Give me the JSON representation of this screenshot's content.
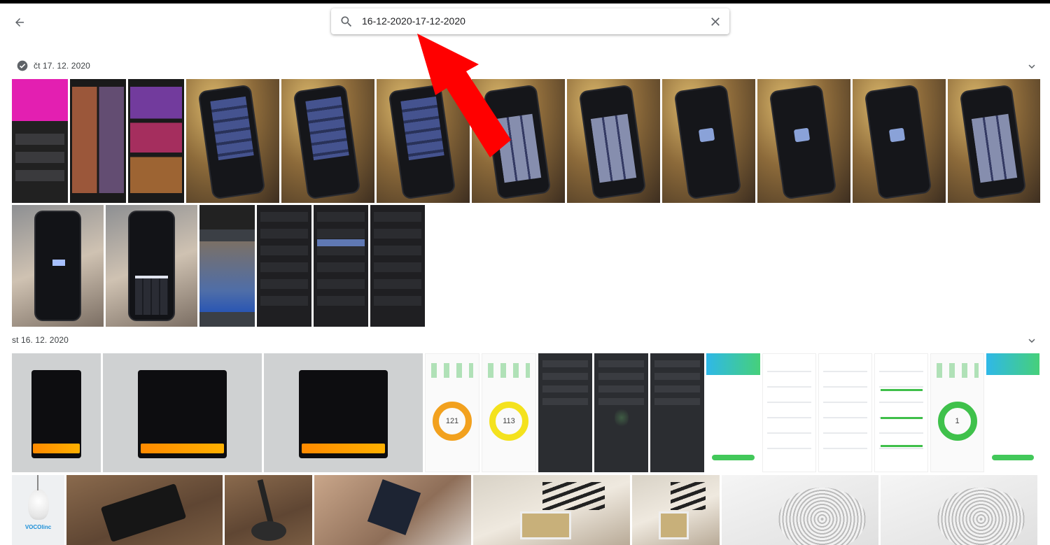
{
  "search": {
    "value": "16-12-2020-17-12-2020",
    "icon": "search-icon",
    "clear_icon": "close-icon"
  },
  "nav": {
    "back_icon": "arrow-back-icon"
  },
  "groups": [
    {
      "date": "čt 17. 12. 2020",
      "selected": true
    },
    {
      "date": "st 16. 12. 2020",
      "selected": false
    }
  ],
  "app_values": {
    "ring_1": "121",
    "ring_2": "113",
    "ring_3": "1"
  },
  "photo_brand": "VOCOlinc",
  "colors": {
    "accent_red": "#ff0000",
    "check_grey": "#5f6368"
  }
}
